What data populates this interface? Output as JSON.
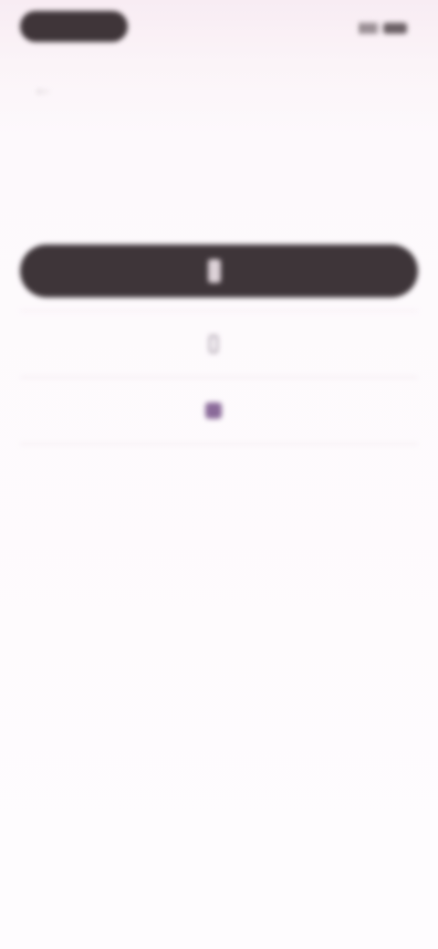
{
  "status_bar": {
    "time": "",
    "signal_icon": "signal-icon",
    "battery_icon": "battery-icon"
  },
  "header": {
    "back_icon": "back-arrow-icon",
    "title": ""
  },
  "intro": {
    "headline": "",
    "subtext": ""
  },
  "primary_button": {
    "icon": "device-icon",
    "label": ""
  },
  "options": [
    {
      "icon": "phone-icon",
      "label": ""
    },
    {
      "icon": "key-icon",
      "label": ""
    }
  ],
  "footer": {
    "text": "",
    "link": ""
  },
  "colors": {
    "background": "#fdf9fc",
    "primary_button": "#3e3539",
    "accent_icon": "#8a6a99"
  }
}
